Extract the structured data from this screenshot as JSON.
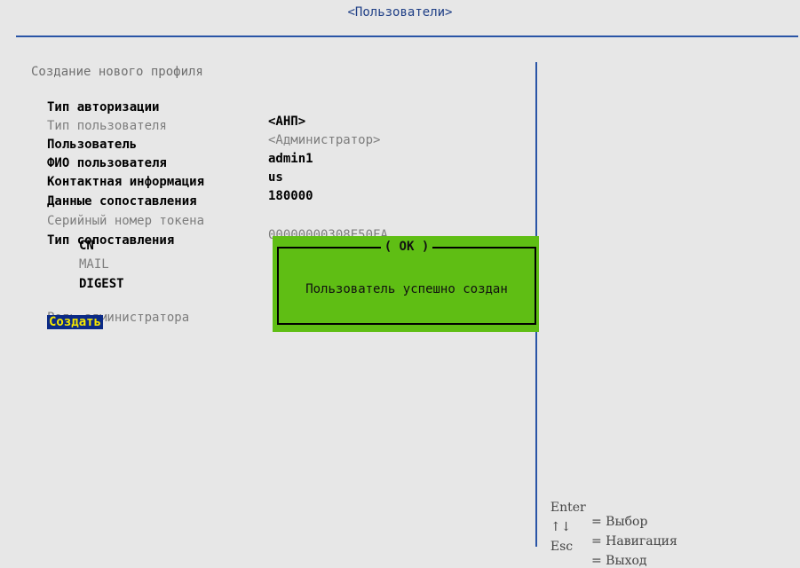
{
  "header": {
    "title": "<Пользователи>"
  },
  "form": {
    "section_title": "Создание нового профиля",
    "auth_type": {
      "label": "Тип авторизации",
      "value": "<АНП>"
    },
    "user_type": {
      "label": "Тип пользователя",
      "value": "<Администратор>"
    },
    "user": {
      "label": "Пользователь",
      "value": "admin1"
    },
    "full_name": {
      "label": "ФИО пользователя",
      "value": "us"
    },
    "contact": {
      "label": "Контактная информация",
      "value": "180000"
    },
    "mapping_data": {
      "label": "Данные сопоставления"
    },
    "token_serial": {
      "label": "Серийный номер токена",
      "value": "00000000308E50FA"
    },
    "mapping_type": {
      "label": "Тип сопоставления",
      "options": [
        "CN",
        "MAIL",
        "DIGEST"
      ]
    },
    "admin_role": {
      "label": "Роль администратора"
    },
    "create": {
      "label": "Создать"
    }
  },
  "dialog": {
    "title": "( OK )",
    "message": "Пользователь успешно создан"
  },
  "help": [
    {
      "key": "Enter",
      "action": "= Выбор"
    },
    {
      "key": "↑↓",
      "action": "= Навигация"
    },
    {
      "key": "Esc",
      "action": "= Выход"
    }
  ]
}
